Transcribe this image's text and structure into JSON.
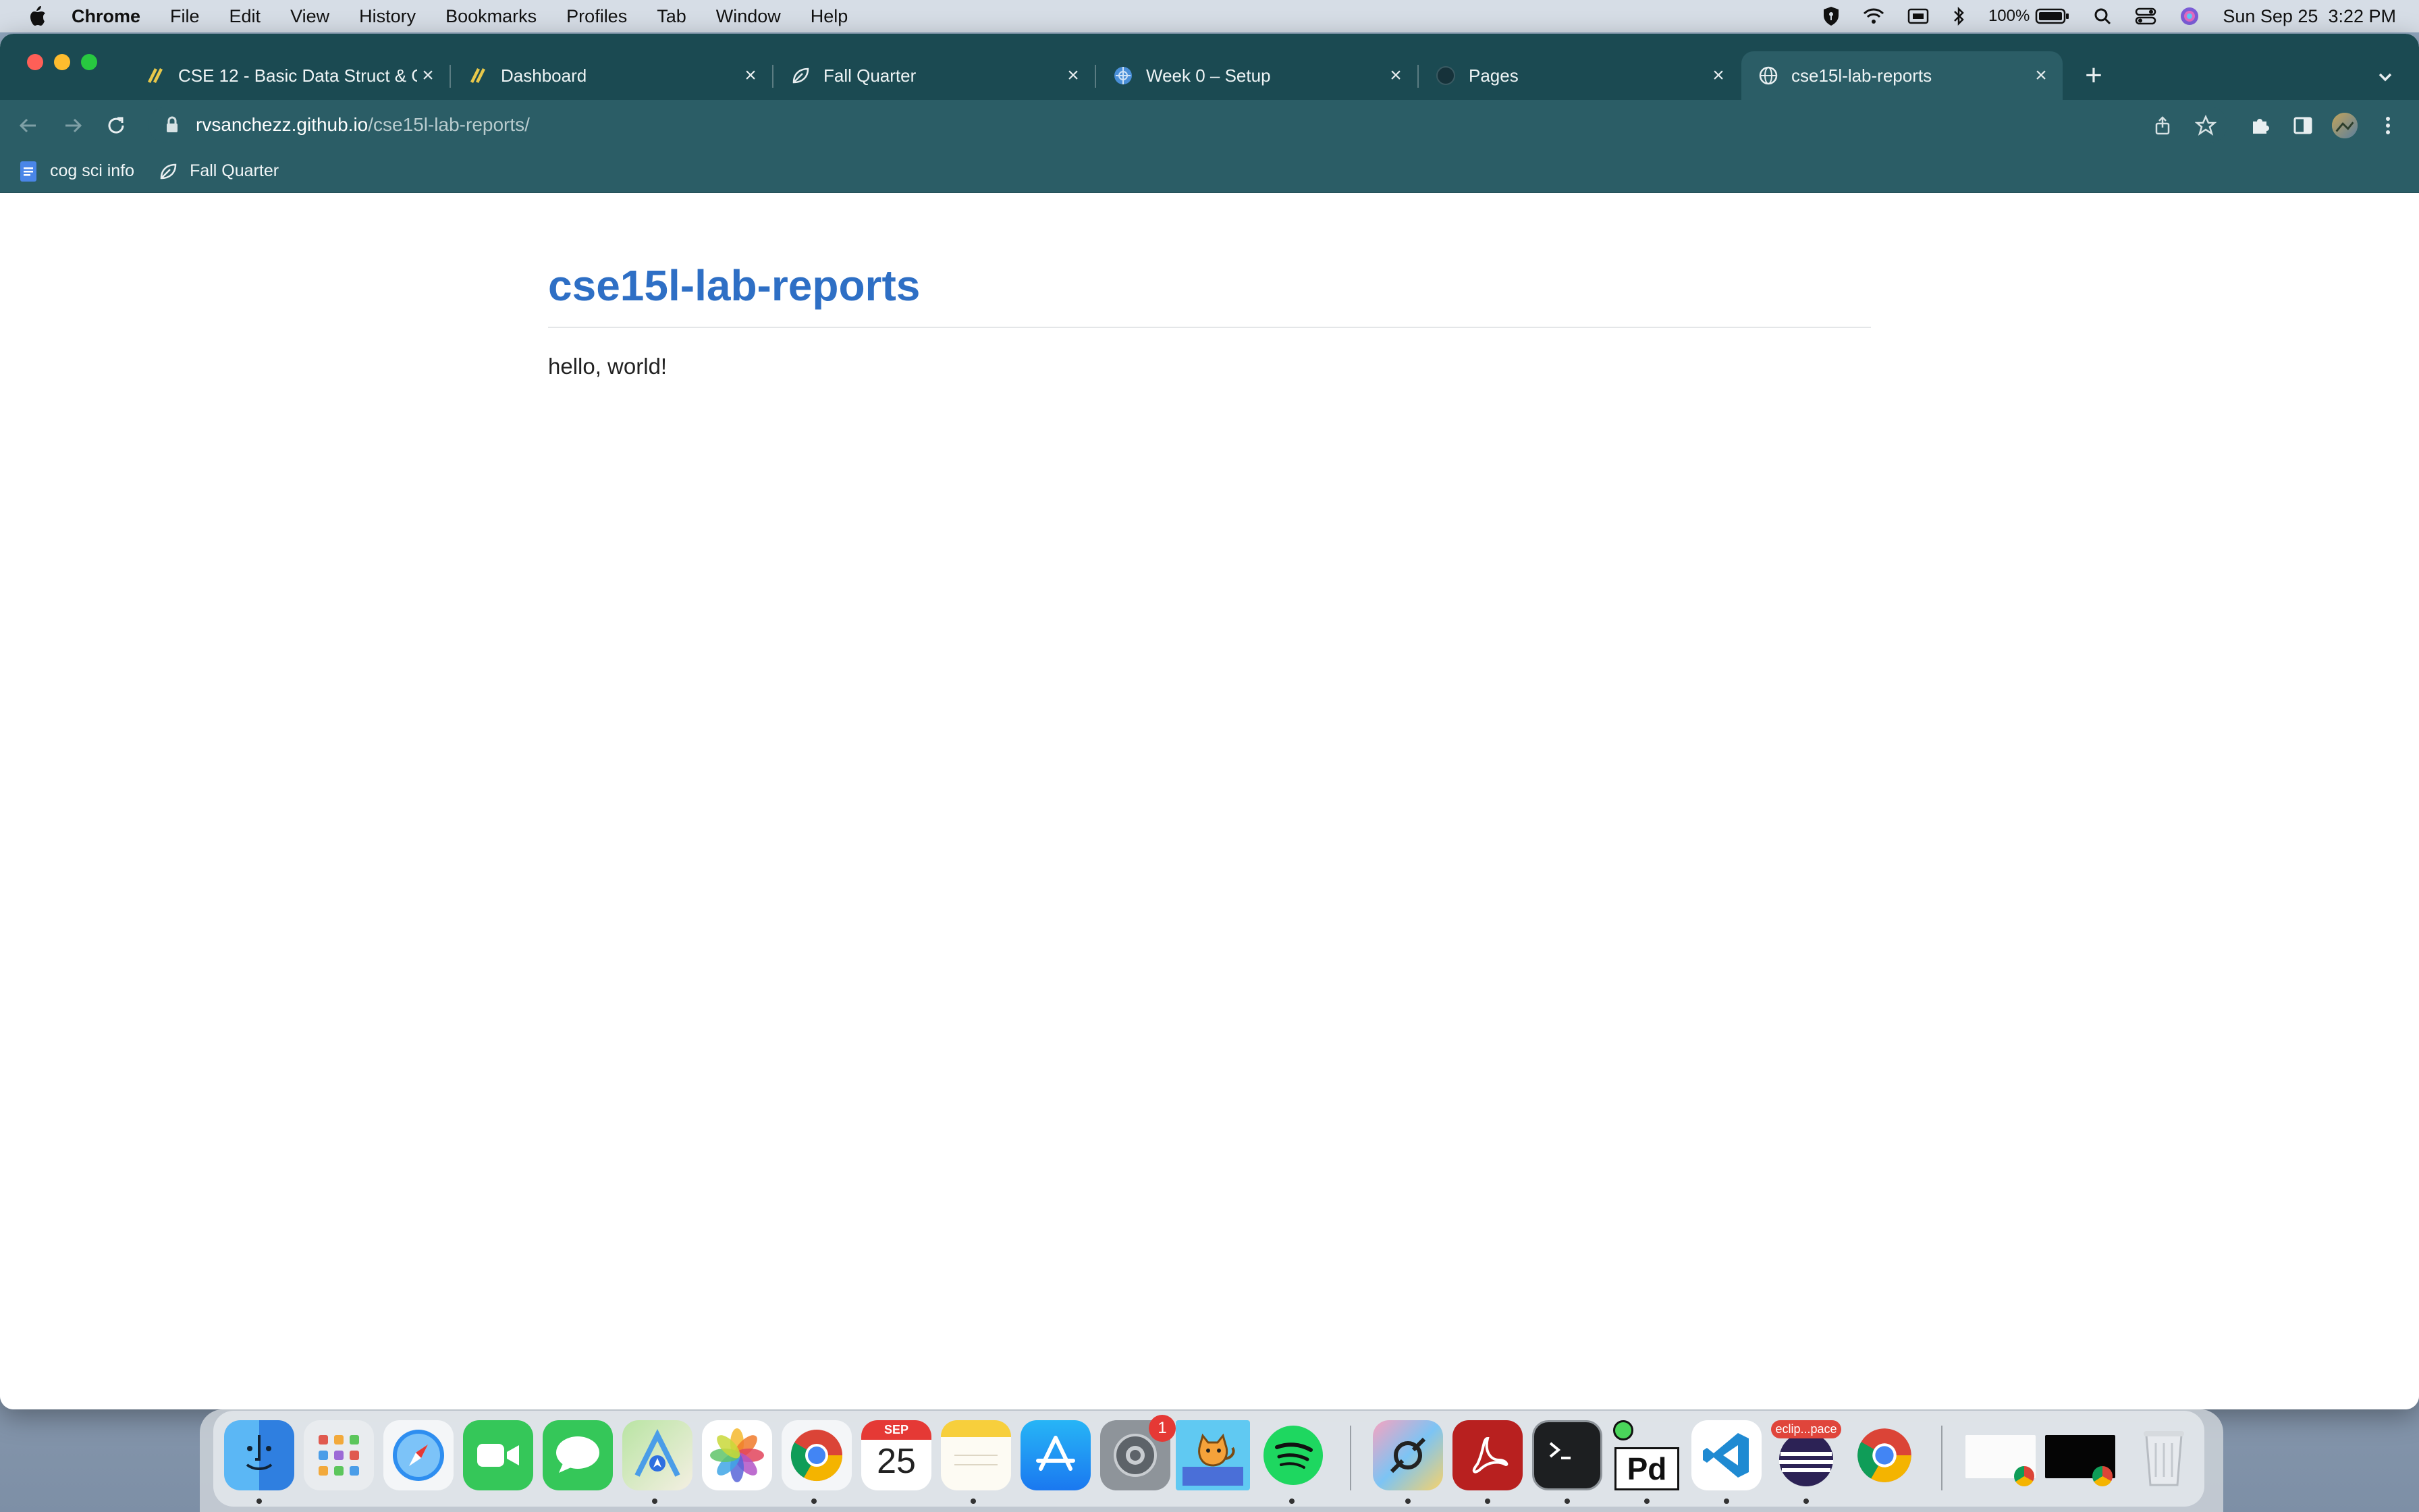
{
  "menubar": {
    "app_name": "Chrome",
    "items": [
      "File",
      "Edit",
      "View",
      "History",
      "Bookmarks",
      "Profiles",
      "Tab",
      "Window",
      "Help"
    ],
    "battery": "100%",
    "datetime": "Sun Sep 25  3:22 PM"
  },
  "tabs": [
    {
      "title": "CSE 12 - Basic Data Struct & O",
      "icon": "canvas-icon"
    },
    {
      "title": "Dashboard",
      "icon": "canvas-icon"
    },
    {
      "title": "Fall Quarter",
      "icon": "notion-leaf-icon"
    },
    {
      "title": "Week 0 – Setup",
      "icon": "globe-wheel-icon"
    },
    {
      "title": "Pages",
      "icon": "github-icon"
    },
    {
      "title": "cse15l-lab-reports",
      "icon": "globe-icon"
    }
  ],
  "address_bar": {
    "host": "rvsanchezz.github.io",
    "path": "/cse15l-lab-reports/"
  },
  "bookmarks": [
    {
      "label": "cog sci info",
      "icon": "docs-icon"
    },
    {
      "label": "Fall Quarter",
      "icon": "notion-leaf-icon"
    }
  ],
  "page": {
    "title": "cse15l-lab-reports",
    "body": "hello, world!",
    "title_color": "#2e6fc5"
  },
  "dock": {
    "calendar_month": "SEP",
    "calendar_day": "25",
    "settings_badge": "1",
    "eclipse_label": "eclip...pace",
    "pd_label": "Pd"
  },
  "colors": {
    "tabstrip": "#1b4a52",
    "toolbar": "#2b5d66"
  }
}
